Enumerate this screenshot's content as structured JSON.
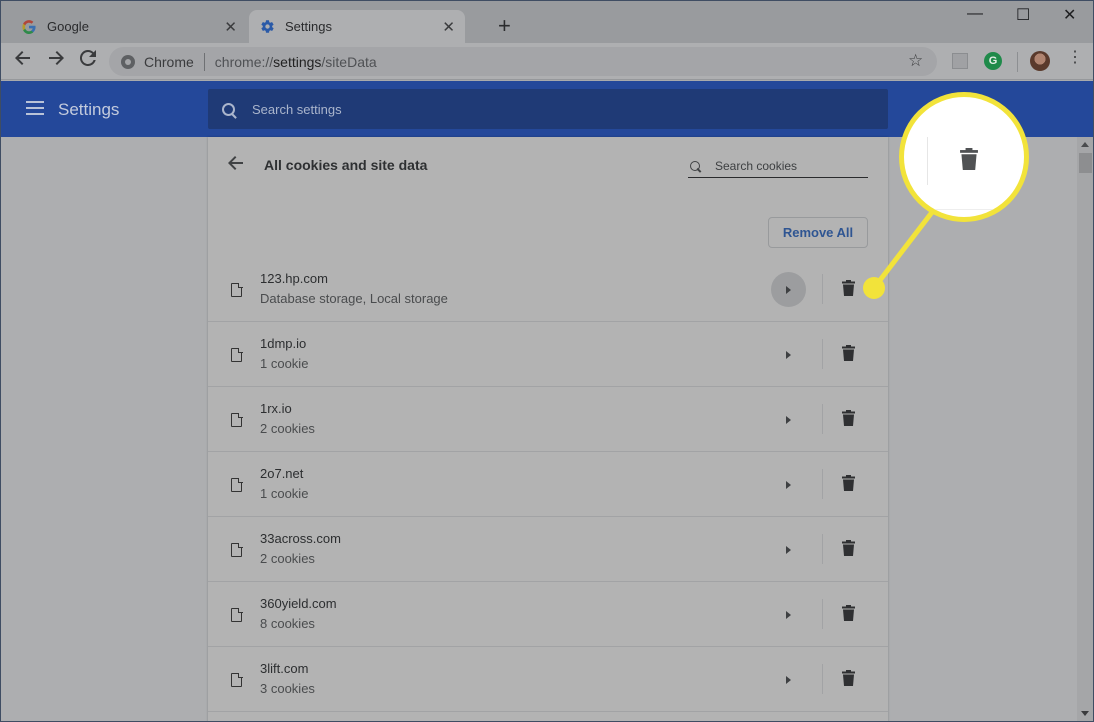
{
  "browser": {
    "tabs": [
      {
        "title": "Google",
        "icon": "google-g-icon",
        "active": false
      },
      {
        "title": "Settings",
        "icon": "gear-icon",
        "active": true
      }
    ],
    "new_tab_label": "+",
    "window_controls": {
      "minimize": "—",
      "maximize": "☐",
      "close": "✕"
    },
    "omnibox": {
      "site_label": "Chrome",
      "url_prefix": "chrome://",
      "url_host": "settings",
      "url_path": "/siteData"
    },
    "extensions": [
      {
        "name": "extension-icon"
      },
      {
        "name": "grammarly-icon",
        "glyph": "G"
      }
    ]
  },
  "settings_header": {
    "title": "Settings",
    "search_placeholder": "Search settings"
  },
  "cookies_page": {
    "title": "All cookies and site data",
    "search_placeholder": "Search cookies",
    "remove_all_label": "Remove All",
    "sites": [
      {
        "site": "123.hp.com",
        "detail": "Database storage, Local storage",
        "hovered": true
      },
      {
        "site": "1dmp.io",
        "detail": "1 cookie",
        "hovered": false
      },
      {
        "site": "1rx.io",
        "detail": "2 cookies",
        "hovered": false
      },
      {
        "site": "2o7.net",
        "detail": "1 cookie",
        "hovered": false
      },
      {
        "site": "33across.com",
        "detail": "2 cookies",
        "hovered": false
      },
      {
        "site": "360yield.com",
        "detail": "8 cookies",
        "hovered": false
      },
      {
        "site": "3lift.com",
        "detail": "3 cookies",
        "hovered": false
      }
    ]
  },
  "callout": {
    "highlighted_control": "trash-icon",
    "color": "#f2e33a"
  }
}
